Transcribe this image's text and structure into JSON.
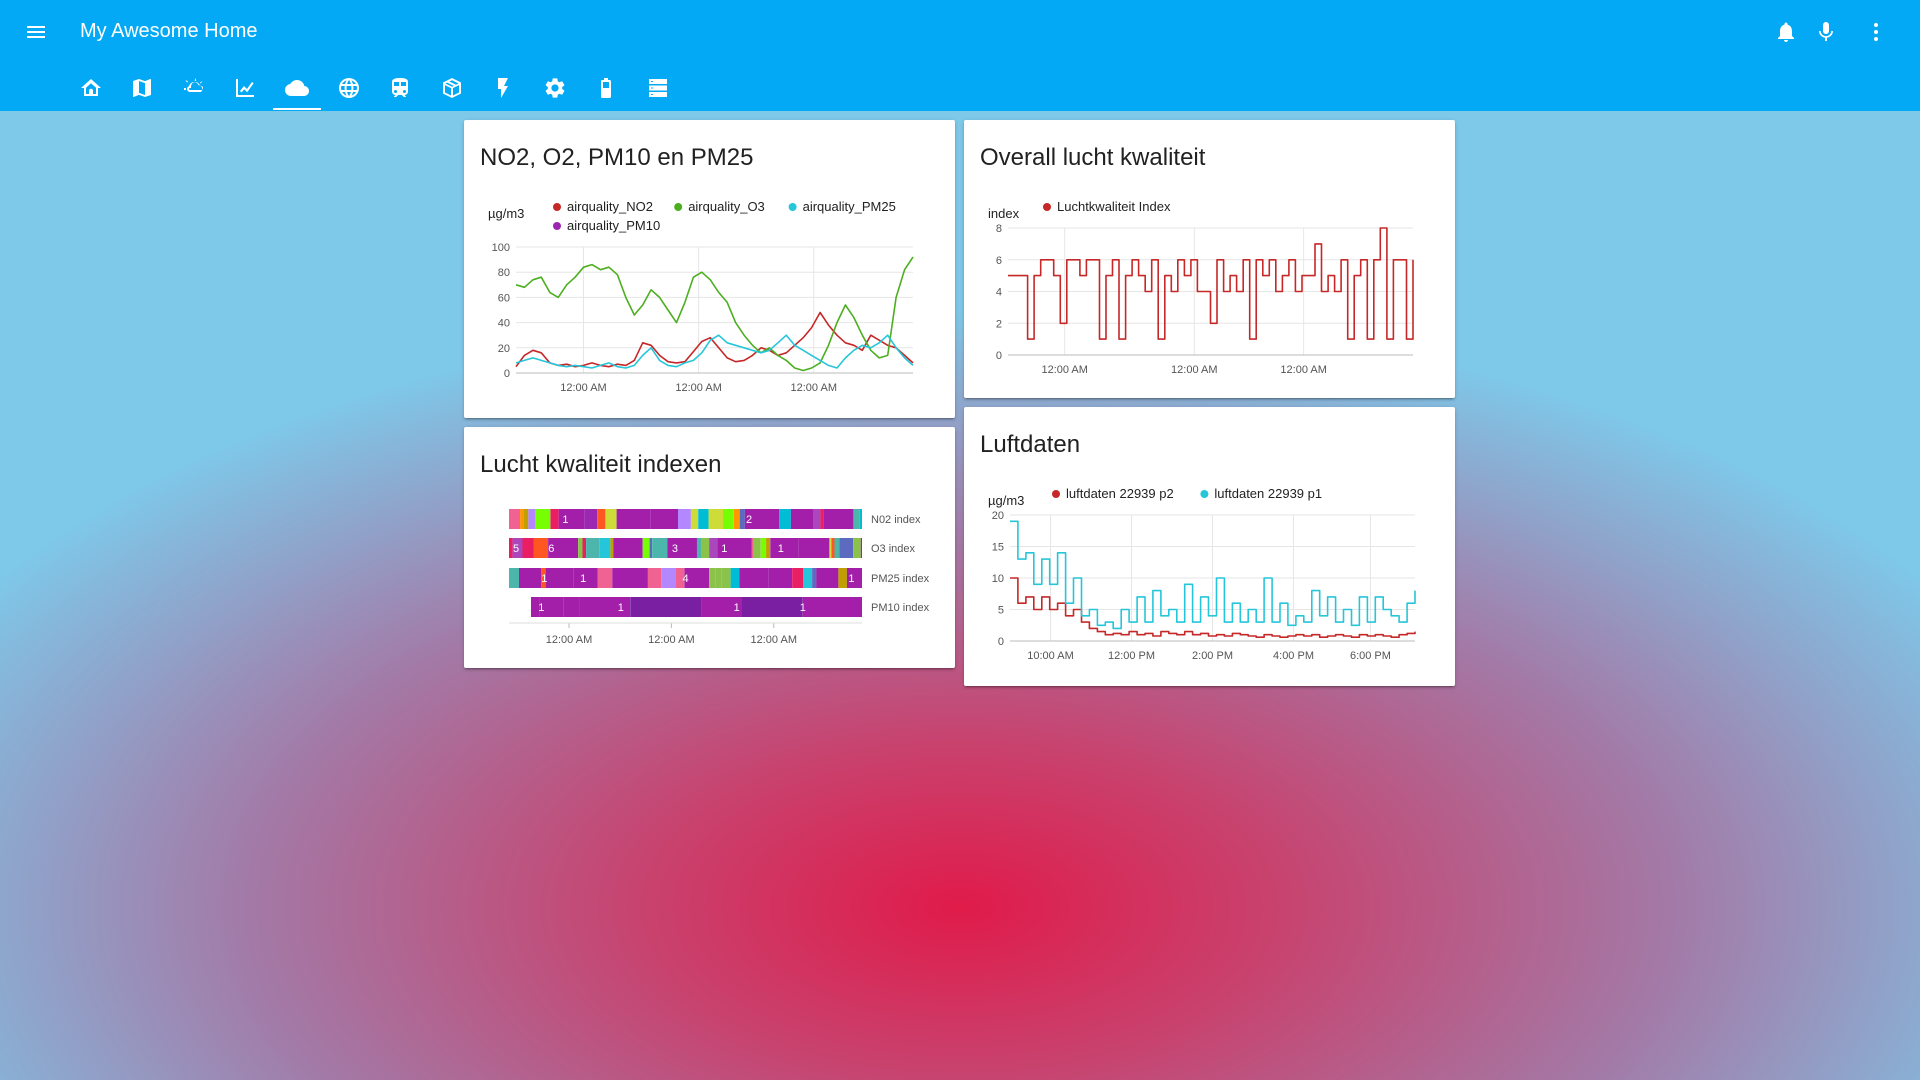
{
  "header": {
    "title": "My Awesome Home",
    "tabs": [
      {
        "icon": "home-assistant-icon"
      },
      {
        "icon": "map-icon"
      },
      {
        "icon": "weather-partly-cloudy-icon"
      },
      {
        "icon": "chart-line-icon"
      },
      {
        "icon": "cloud-icon",
        "active": true
      },
      {
        "icon": "globe-icon"
      },
      {
        "icon": "train-icon"
      },
      {
        "icon": "package-icon"
      },
      {
        "icon": "flash-icon"
      },
      {
        "icon": "settings-icon"
      },
      {
        "icon": "battery-icon"
      },
      {
        "icon": "server-icon"
      }
    ],
    "actions": [
      "bell-icon",
      "microphone-icon",
      "dots-vertical-icon"
    ]
  },
  "colors": {
    "header": "#03a9f4",
    "no2": "#c62828",
    "o3": "#4caf20",
    "pm25": "#26c6da",
    "pm10": "#9c27b0",
    "index": "#c62828",
    "p2": "#c62828",
    "p1": "#26c6da"
  },
  "cards": {
    "pollutants": {
      "title": "NO2, O2, PM10 en PM25"
    },
    "overall": {
      "title": "Overall lucht kwaliteit"
    },
    "indexes": {
      "title": "Lucht kwaliteit indexen"
    },
    "luftdaten": {
      "title": "Luftdaten"
    }
  },
  "chart_data": [
    {
      "type": "line",
      "title": "NO2, O2, PM10 en PM25",
      "ylabel": "µg/m3",
      "ylim": [
        0,
        100
      ],
      "yticks": [
        0,
        20,
        40,
        60,
        80,
        100
      ],
      "xticks": [
        "12:00 AM",
        "12:00 AM",
        "12:00 AM"
      ],
      "grid": true,
      "legend": "top",
      "series": [
        {
          "name": "airquality_NO2",
          "values": [
            5,
            14,
            18,
            16,
            8,
            6,
            7,
            5,
            6,
            8,
            6,
            5,
            7,
            6,
            10,
            24,
            22,
            14,
            9,
            8,
            9,
            17,
            25,
            28,
            20,
            12,
            9,
            10,
            14,
            20,
            18,
            14,
            16,
            22,
            28,
            36,
            48,
            38,
            30,
            24,
            22,
            18,
            30,
            26,
            22,
            20,
            14,
            8
          ]
        },
        {
          "name": "airquality_O3",
          "values": [
            70,
            68,
            74,
            76,
            64,
            60,
            70,
            76,
            84,
            86,
            82,
            84,
            78,
            60,
            46,
            54,
            66,
            60,
            50,
            40,
            56,
            76,
            80,
            74,
            64,
            56,
            40,
            30,
            22,
            16,
            20,
            14,
            10,
            4,
            2,
            4,
            8,
            22,
            40,
            54,
            44,
            30,
            18,
            12,
            14,
            60,
            82,
            92
          ]
        },
        {
          "name": "airquality_PM25",
          "values": [
            8,
            10,
            12,
            10,
            8,
            6,
            5,
            6,
            5,
            4,
            6,
            8,
            5,
            4,
            6,
            14,
            20,
            10,
            6,
            5,
            8,
            10,
            16,
            26,
            30,
            24,
            22,
            20,
            18,
            16,
            18,
            24,
            30,
            22,
            18,
            14,
            10,
            6,
            4,
            12,
            18,
            22,
            20,
            24,
            30,
            20,
            12,
            6
          ]
        },
        {
          "name": "airquality_PM10",
          "values": []
        }
      ]
    },
    {
      "type": "line",
      "title": "Overall lucht kwaliteit",
      "ylabel": "index",
      "ylim": [
        0,
        8
      ],
      "yticks": [
        0,
        2,
        4,
        6,
        8
      ],
      "xticks": [
        "12:00 AM",
        "12:00 AM",
        "12:00 AM"
      ],
      "grid": true,
      "legend": "top",
      "series": [
        {
          "name": "Luchtkwaliteit Index",
          "values": [
            5,
            5,
            5,
            1,
            5,
            6,
            6,
            5,
            2,
            6,
            6,
            5,
            6,
            6,
            1,
            5,
            6,
            1,
            5,
            6,
            5,
            4,
            6,
            1,
            5,
            4,
            6,
            5,
            6,
            4,
            4,
            2,
            6,
            4,
            5,
            4,
            6,
            1,
            6,
            5,
            6,
            4,
            5,
            6,
            4,
            5,
            5,
            7,
            4,
            5,
            4,
            6,
            1,
            5,
            6,
            1,
            6,
            8,
            1,
            6,
            6,
            1,
            6
          ]
        }
      ]
    },
    {
      "type": "heatmap",
      "title": "Lucht kwaliteit indexen",
      "xticks": [
        "12:00 AM",
        "12:00 AM",
        "12:00 AM"
      ],
      "rows": [
        {
          "name": "N02 index",
          "labels": [
            "1",
            "2"
          ]
        },
        {
          "name": "O3 index",
          "labels": [
            "5",
            "6",
            "3",
            "1",
            "1"
          ]
        },
        {
          "name": "PM25 index",
          "labels": [
            "1",
            "1",
            "4",
            "1"
          ]
        },
        {
          "name": "PM10 index",
          "labels": [
            "1",
            "1",
            "1",
            "1"
          ]
        }
      ]
    },
    {
      "type": "line",
      "title": "Luftdaten",
      "ylabel": "µg/m3",
      "ylim": [
        0,
        20
      ],
      "yticks": [
        0,
        5,
        10,
        15,
        20
      ],
      "xticks": [
        "10:00 AM",
        "12:00 PM",
        "2:00 PM",
        "4:00 PM",
        "6:00 PM"
      ],
      "grid": true,
      "legend": "top",
      "series": [
        {
          "name": "luftdaten 22939 p2",
          "values": [
            10,
            6,
            7,
            5,
            7,
            5,
            6,
            4,
            5,
            3,
            2,
            1.5,
            1,
            1.2,
            1,
            1.5,
            1,
            1.2,
            0.8,
            1.5,
            1.2,
            1,
            1.5,
            1,
            1.2,
            0.8,
            1,
            0.8,
            1.2,
            1,
            0.8,
            0.6,
            1,
            0.8,
            0.6,
            0.8,
            1,
            0.8,
            1,
            0.6,
            0.8,
            1,
            0.8,
            0.6,
            1,
            0.8,
            1,
            0.8,
            0.6,
            1,
            1.2,
            1.5
          ]
        },
        {
          "name": "luftdaten 22939 p1",
          "values": [
            19,
            13,
            14,
            9,
            13,
            9,
            14,
            6,
            10,
            4,
            5,
            2.5,
            3,
            2,
            5,
            3,
            7,
            3,
            8,
            4,
            5,
            3,
            9,
            3,
            7,
            4,
            10,
            3,
            6,
            3,
            5,
            3,
            10,
            3,
            6,
            2.5,
            4,
            3,
            8,
            4,
            7,
            3,
            5,
            2.5,
            7,
            3,
            7,
            5,
            4,
            3,
            6,
            8
          ]
        }
      ]
    }
  ]
}
